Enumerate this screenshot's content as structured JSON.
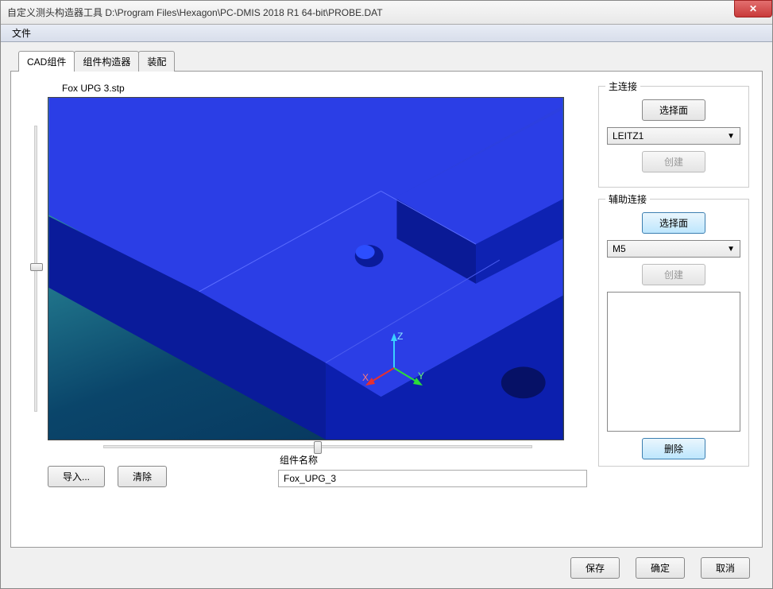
{
  "window": {
    "title": "自定义测头构造器工具  D:\\Program Files\\Hexagon\\PC-DMIS 2018 R1 64-bit\\PROBE.DAT"
  },
  "menu": {
    "file": "文件"
  },
  "tabs": {
    "cad": "CAD组件",
    "builder": "组件构造器",
    "assembly": "装配"
  },
  "viewport": {
    "filename": "Fox UPG 3.stp",
    "axis_x": "X",
    "axis_y": "Y",
    "axis_z": "Z"
  },
  "main_conn": {
    "label": "主连接",
    "select_face": "选择面",
    "type_value": "LEITZ1",
    "create": "创建"
  },
  "aux_conn": {
    "label": "辅助连接",
    "select_face": "选择面",
    "type_value": "M5",
    "create": "创建",
    "delete": "删除"
  },
  "component": {
    "name_label": "组件名称",
    "name_value": "Fox_UPG_3",
    "import": "导入...",
    "clear": "清除"
  },
  "footer": {
    "save": "保存",
    "ok": "确定",
    "cancel": "取消"
  }
}
